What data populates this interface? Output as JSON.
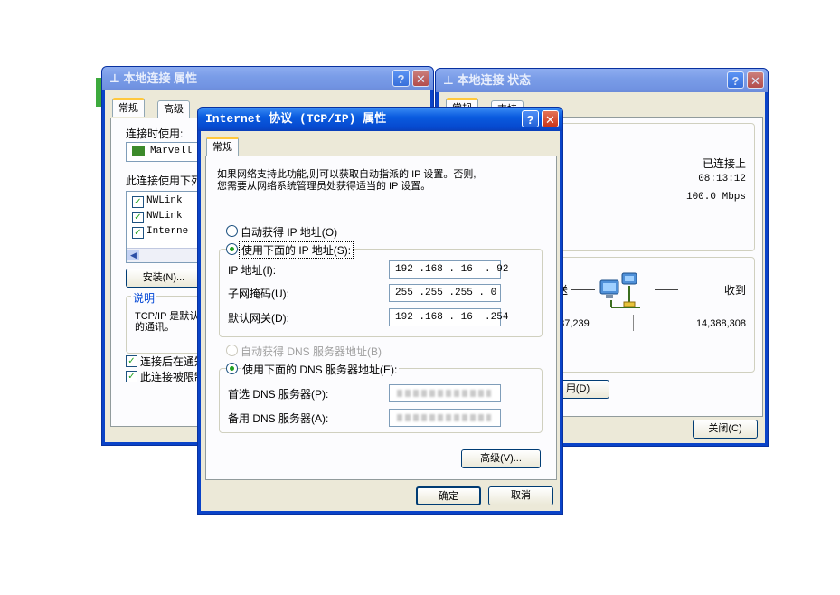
{
  "left_window": {
    "title": "本地连接 属性",
    "tabs": [
      "常规",
      "高级"
    ],
    "connect_using_label": "连接时使用:",
    "adapter": "Marvell Y",
    "items_label": "此连接使用下列",
    "items": [
      "NWLink",
      "NWLink",
      "Interne"
    ],
    "install_button": "安装(N)...",
    "description_label": "说明",
    "description_text": [
      "TCP/IP 是默认",
      "的通讯。"
    ],
    "show_icon_checkbox": "连接后在通知",
    "notify_checkbox": "此连接被限制"
  },
  "right_window": {
    "title": "本地连接 状态",
    "tabs": [
      "常规",
      "支持"
    ],
    "status": "已连接上",
    "duration": "08:13:12",
    "speed": "100.0 Mbps",
    "sent_label": "发送",
    "received_label": "收到",
    "packets_sent": "437,239",
    "packets_received": "14,388,308",
    "disable_button": "用(D)",
    "close_button": "关闭(C)"
  },
  "tcpip_dialog": {
    "title": "Internet 协议 (TCP/IP) 属性",
    "tab": "常规",
    "intro_line1": "如果网络支持此功能,则可以获取自动指派的 IP 设置。否则,",
    "intro_line2": "您需要从网络系统管理员处获得适当的 IP 设置。",
    "auto_ip": "自动获得 IP 地址(O)",
    "manual_ip": "使用下面的 IP 地址(S):",
    "ip_label": "IP 地址(I):",
    "ip_value": "192 .168 . 16  . 92",
    "mask_label": "子网掩码(U):",
    "mask_value": "255 .255 .255 . 0",
    "gateway_label": "默认网关(D):",
    "gateway_value": "192 .168 . 16  .254",
    "auto_dns": "自动获得 DNS 服务器地址(B)",
    "manual_dns": "使用下面的 DNS 服务器地址(E):",
    "preferred_dns_label": "首选 DNS 服务器(P):",
    "alternate_dns_label": "备用 DNS 服务器(A):",
    "advanced_button": "高级(V)...",
    "ok_button": "确定",
    "cancel_button": "取消"
  },
  "icons": {
    "help": "?",
    "close": "✕"
  },
  "colors": {
    "title_active": "#0a5bdf",
    "title_inactive": "#7a9de8",
    "dialog_bg": "#ece9d8",
    "tab_accent": "#ffc83c"
  }
}
